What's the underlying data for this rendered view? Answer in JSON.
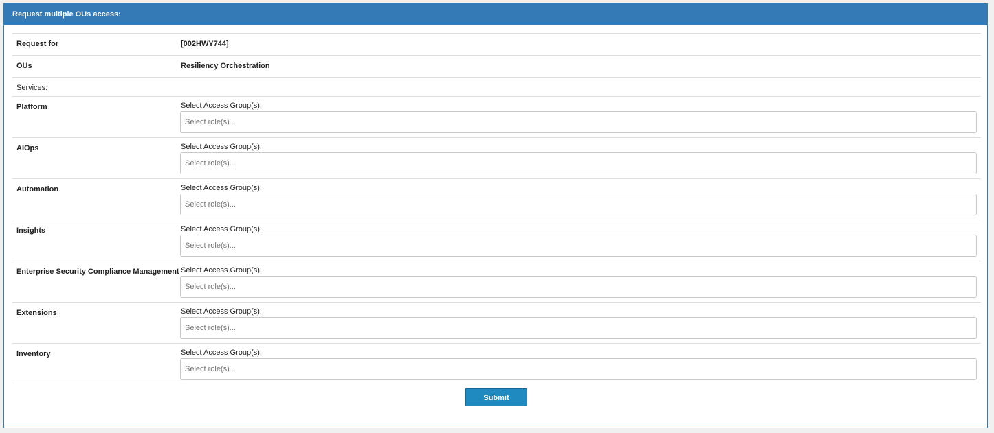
{
  "header": {
    "title": "Request multiple OUs access:"
  },
  "request_for": {
    "label": "Request for",
    "value": "[002HWY744]"
  },
  "ous": {
    "label": "OUs",
    "value": "Resiliency Orchestration"
  },
  "services_label": "Services:",
  "access_group_label": "Select Access Group(s):",
  "role_placeholder": "Select role(s)...",
  "services": [
    {
      "name": "Platform"
    },
    {
      "name": "AIOps"
    },
    {
      "name": "Automation"
    },
    {
      "name": "Insights"
    },
    {
      "name": "Enterprise Security Compliance Management"
    },
    {
      "name": "Extensions"
    },
    {
      "name": "Inventory"
    }
  ],
  "submit_label": "Submit",
  "colors": {
    "accent": "#337ab7",
    "button": "#1f8ac0"
  }
}
